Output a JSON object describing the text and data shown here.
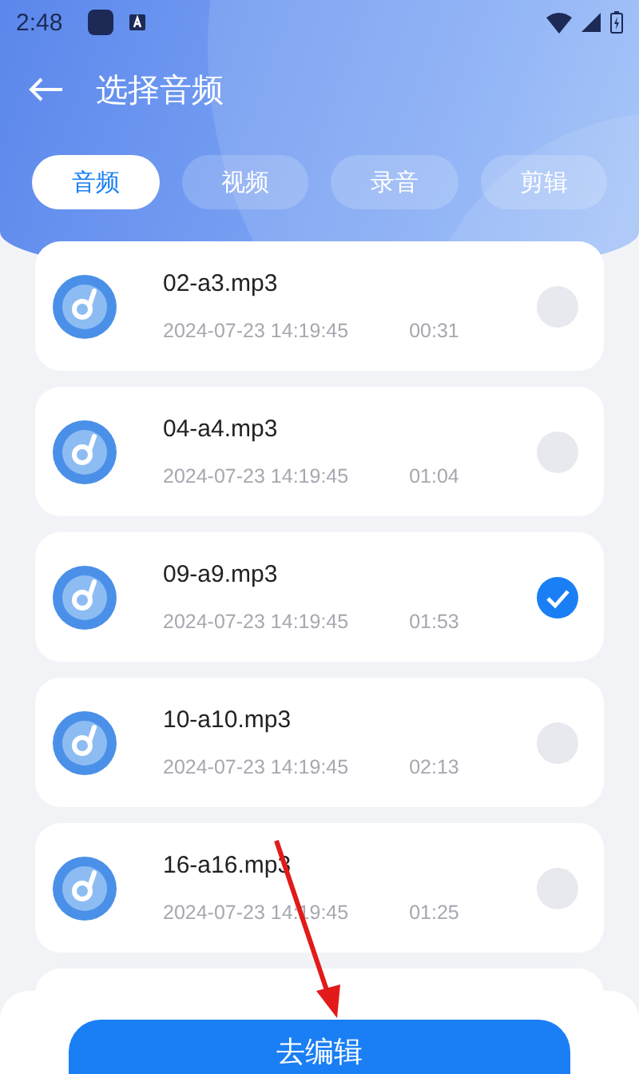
{
  "status_bar": {
    "time": "2:48"
  },
  "header": {
    "title": "选择音频"
  },
  "tabs": [
    {
      "label": "音频",
      "selected": true
    },
    {
      "label": "视频",
      "selected": false
    },
    {
      "label": "录音",
      "selected": false
    },
    {
      "label": "剪辑",
      "selected": false
    }
  ],
  "files": [
    {
      "name": "02-a3.mp3",
      "date": "2024-07-23 14:19:45",
      "duration": "00:31",
      "selected": false
    },
    {
      "name": "04-a4.mp3",
      "date": "2024-07-23 14:19:45",
      "duration": "01:04",
      "selected": false
    },
    {
      "name": "09-a9.mp3",
      "date": "2024-07-23 14:19:45",
      "duration": "01:53",
      "selected": true
    },
    {
      "name": "10-a10.mp3",
      "date": "2024-07-23 14:19:45",
      "duration": "02:13",
      "selected": false
    },
    {
      "name": "16-a16.mp3",
      "date": "2024-07-23 14:19:45",
      "duration": "01:25",
      "selected": false
    }
  ],
  "action_button": {
    "label": "去编辑"
  }
}
